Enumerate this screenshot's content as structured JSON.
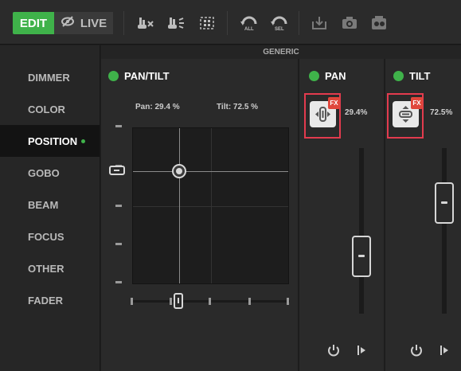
{
  "toolbar": {
    "edit_label": "EDIT",
    "live_label": "LIVE",
    "icons": [
      "visibility-off-icon",
      "clear-selection-icon",
      "highlight-icon",
      "grid-icon",
      "undo-all-icon",
      "undo-selected-icon",
      "store-icon",
      "snapshot-icon",
      "fixture-library-icon"
    ],
    "accent": "#3fb24a"
  },
  "sidebar": {
    "items": [
      {
        "label": "DIMMER"
      },
      {
        "label": "COLOR"
      },
      {
        "label": "POSITION",
        "active": true
      },
      {
        "label": "GOBO"
      },
      {
        "label": "BEAM"
      },
      {
        "label": "FOCUS"
      },
      {
        "label": "OTHER"
      },
      {
        "label": "FADER"
      }
    ]
  },
  "main": {
    "group_header": "GENERIC",
    "pantilt": {
      "title": "PAN/TILT",
      "pan_readout": "Pan: 29.4 %",
      "tilt_readout": "Tilt: 72.5 %",
      "pan_value": 0.294,
      "tilt_value": 0.725
    },
    "pan": {
      "title": "PAN",
      "fx_label": "FX",
      "value_text": "29.4%",
      "level": 0.294
    },
    "tilt": {
      "title": "TILT",
      "fx_label": "FX",
      "value_text": "72.5%",
      "level": 0.725
    },
    "highlight_color": "#e33b4e"
  }
}
